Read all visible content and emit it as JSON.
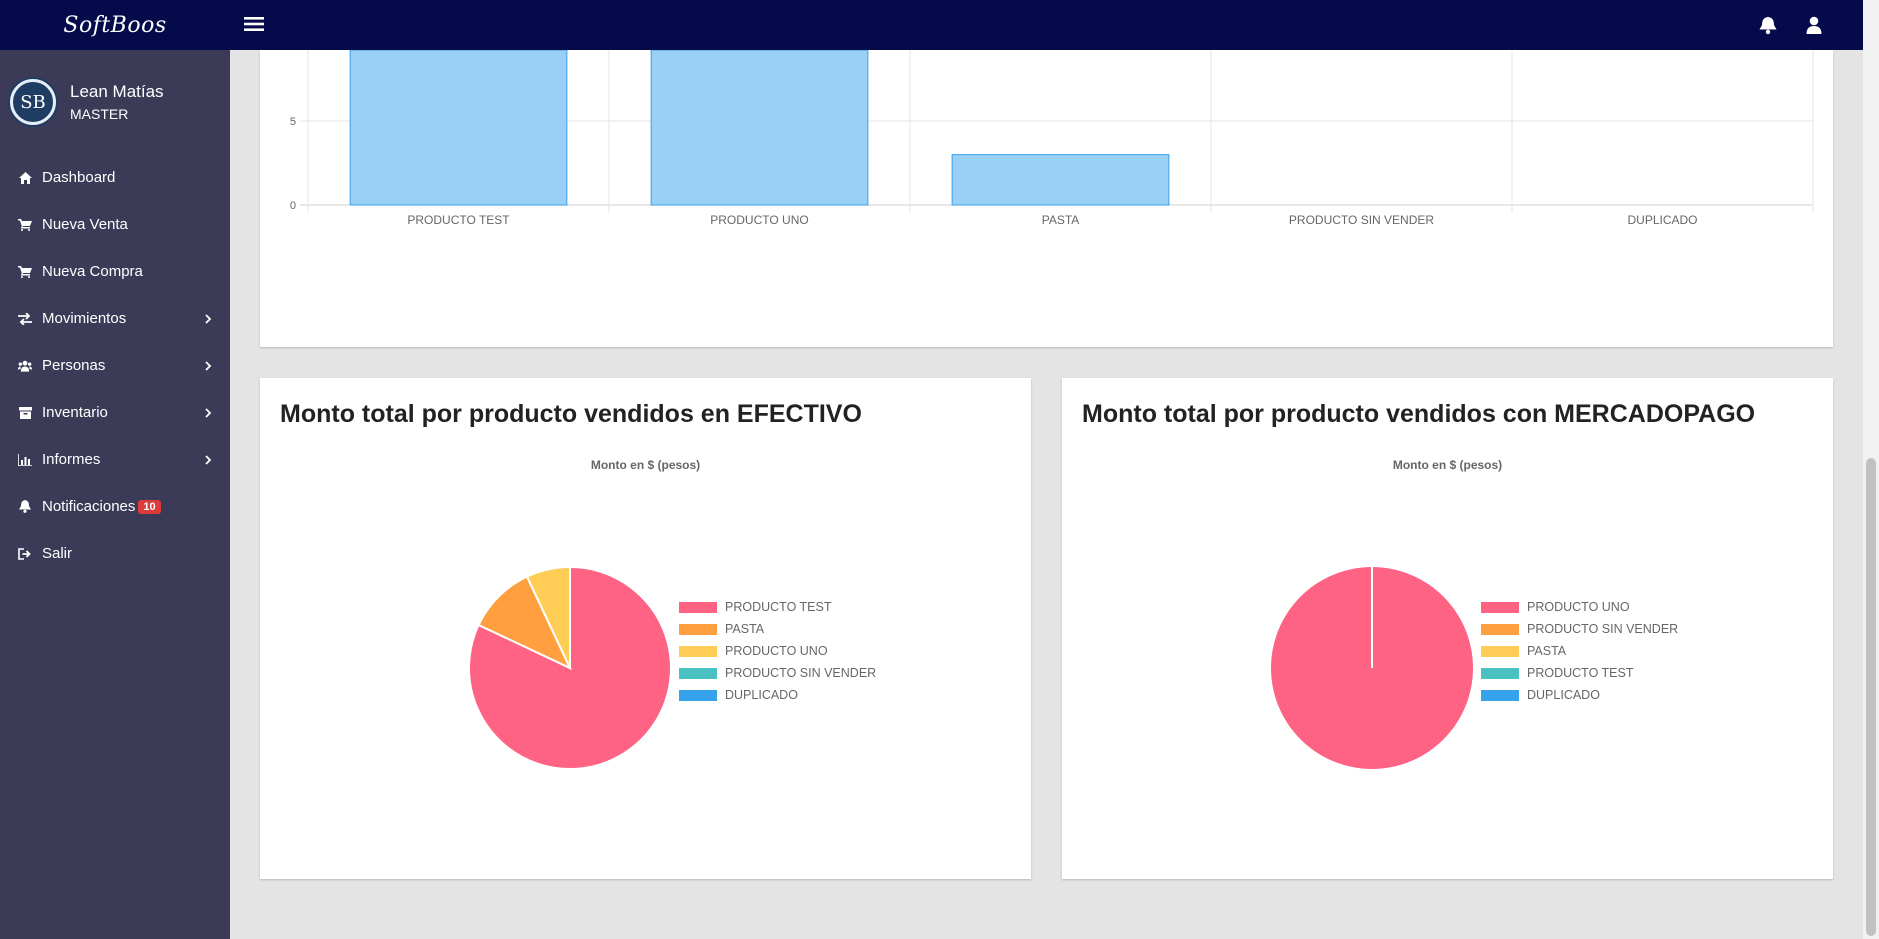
{
  "brand": "SoftBoos",
  "user": {
    "initials": "SB",
    "name": "Lean Matías",
    "role": "MASTER"
  },
  "menu": [
    {
      "label": "Dashboard",
      "icon": "home-icon",
      "submenu": false
    },
    {
      "label": "Nueva Venta",
      "icon": "cart-icon",
      "submenu": false
    },
    {
      "label": "Nueva Compra",
      "icon": "cart-icon",
      "submenu": false
    },
    {
      "label": "Movimientos",
      "icon": "exchange-icon",
      "submenu": true
    },
    {
      "label": "Personas",
      "icon": "users-icon",
      "submenu": true
    },
    {
      "label": "Inventario",
      "icon": "archive-icon",
      "submenu": true
    },
    {
      "label": "Informes",
      "icon": "bar-chart-icon",
      "submenu": true
    },
    {
      "label": "Notificaciones",
      "icon": "bell-icon",
      "submenu": false,
      "badge": "10"
    },
    {
      "label": "Salir",
      "icon": "sign-out-icon",
      "submenu": false
    }
  ],
  "colors": {
    "navy": "#050a4a",
    "sidebar": "#3b3b58",
    "bar_fill": "#9ad0f5",
    "bar_border": "#36a2eb",
    "pink": "#ff6384",
    "orange": "#ff9f40",
    "yellow": "#ffcd56",
    "teal": "#4bc0c0",
    "blue": "#36a2eb"
  },
  "chart_data": [
    {
      "type": "bar",
      "title": "",
      "categories": [
        "PRODUCTO TEST",
        "PRODUCTO UNO",
        "PASTA",
        "PRODUCTO SIN VENDER",
        "DUPLICADO"
      ],
      "values": [
        10,
        10,
        3,
        0,
        0
      ],
      "y_ticks_visible": [
        "0",
        "5"
      ],
      "ylim": [
        0,
        10
      ],
      "note_visible_range": [
        0,
        7.6
      ],
      "grid": true
    },
    {
      "type": "pie",
      "title": "Monto total por producto vendidos en EFECTIVO",
      "subtitle": "Monto en $ (pesos)",
      "labels": [
        "PRODUCTO TEST",
        "PASTA",
        "PRODUCTO UNO",
        "PRODUCTO SIN VENDER",
        "DUPLICADO"
      ],
      "values": [
        82,
        11,
        7,
        0,
        0
      ],
      "colors": [
        "#ff6384",
        "#ff9f40",
        "#ffcd56",
        "#4bc0c0",
        "#36a2eb"
      ],
      "legend": "right"
    },
    {
      "type": "pie",
      "title": "Monto total por producto vendidos con MERCADOPAGO",
      "subtitle": "Monto en $ (pesos)",
      "labels": [
        "PRODUCTO UNO",
        "PRODUCTO SIN VENDER",
        "PASTA",
        "PRODUCTO TEST",
        "DUPLICADO"
      ],
      "values": [
        100,
        0,
        0,
        0,
        0
      ],
      "colors": [
        "#ff6384",
        "#ff9f40",
        "#ffcd56",
        "#4bc0c0",
        "#36a2eb"
      ],
      "legend": "right"
    }
  ]
}
